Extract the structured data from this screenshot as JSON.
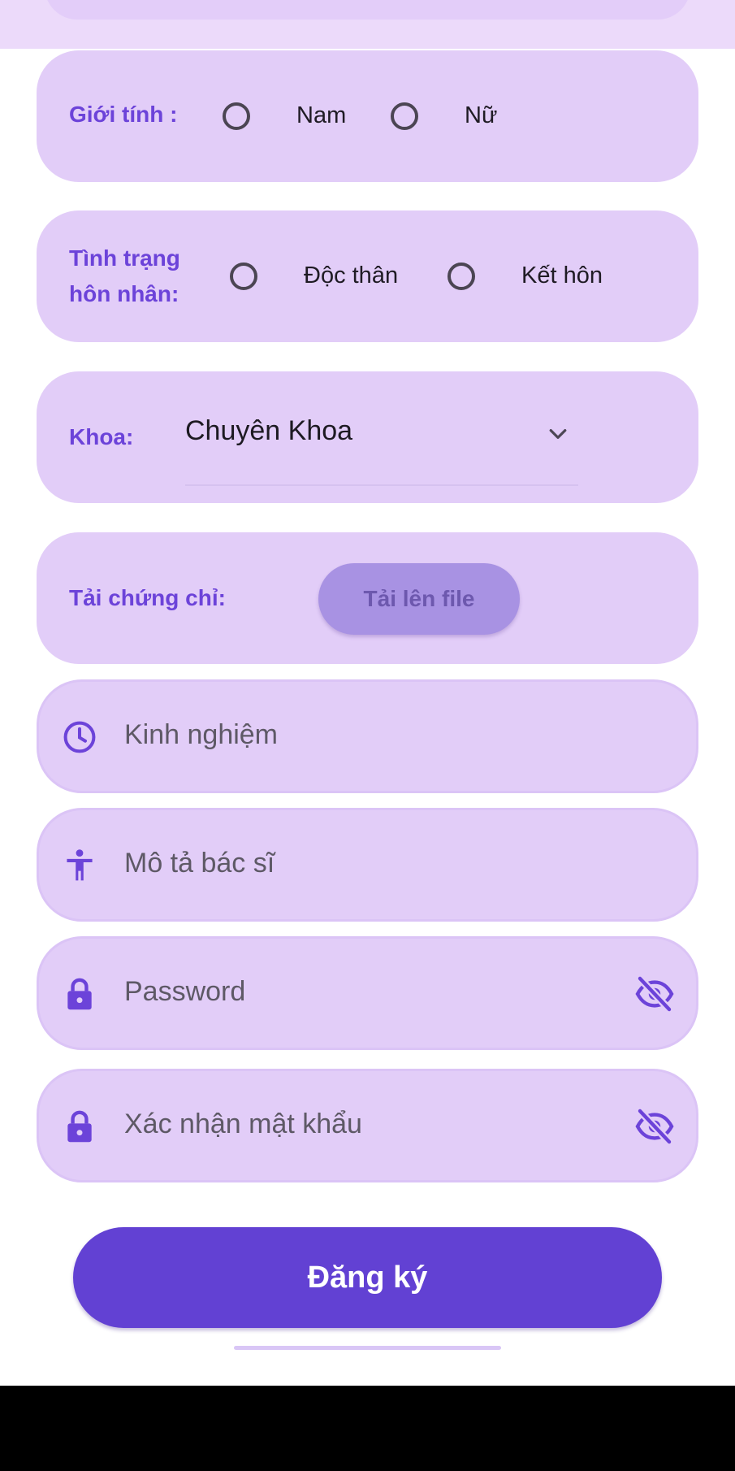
{
  "gender": {
    "label": "Giới tính :",
    "options": [
      "Nam",
      "Nữ"
    ]
  },
  "marital": {
    "label_line1": "Tình trạng",
    "label_line2": "hôn nhân:",
    "options": [
      "Độc thân",
      "Kết hôn"
    ]
  },
  "department": {
    "label": "Khoa:",
    "selected": "Chuyên Khoa"
  },
  "certificate": {
    "label": "Tải chứng chỉ:",
    "button": "Tải lên file"
  },
  "fields": {
    "experience_placeholder": "Kinh nghiệm",
    "description_placeholder": "Mô tả bác sĩ",
    "password_placeholder": "Password",
    "confirm_placeholder": "Xác nhận mật khẩu"
  },
  "submit_label": "Đăng ký",
  "colors": {
    "accent": "#6241d3",
    "card": "#e2cdf8",
    "label": "#6c43d9"
  }
}
